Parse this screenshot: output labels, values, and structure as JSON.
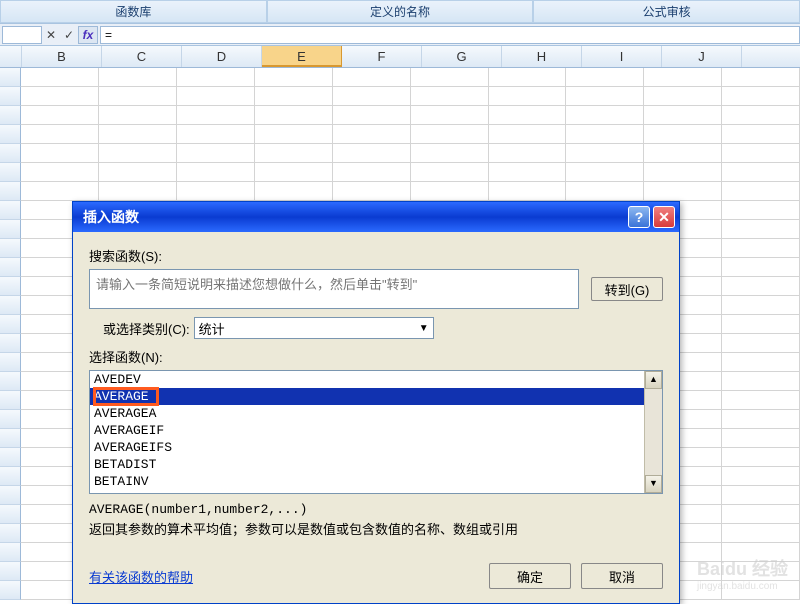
{
  "ribbon": {
    "labels": [
      "函数库",
      "定义的名称",
      "公式审核"
    ]
  },
  "formula_bar": {
    "name_box": "",
    "cancel": "✕",
    "confirm": "✓",
    "fx_label": "fx",
    "value": "="
  },
  "columns": [
    "B",
    "C",
    "D",
    "E",
    "F",
    "G",
    "H",
    "I",
    "J"
  ],
  "active_column": "E",
  "dialog": {
    "title": "插入函数",
    "search_label": "搜索函数(S):",
    "search_placeholder": "请输入一条简短说明来描述您想做什么，然后单击\"转到\"",
    "go_label": "转到(G)",
    "category_label": "或选择类别(C):",
    "category_value": "统计",
    "list_label": "选择函数(N):",
    "functions": [
      "AVEDEV",
      "AVERAGE",
      "AVERAGEA",
      "AVERAGEIF",
      "AVERAGEIFS",
      "BETADIST",
      "BETAINV"
    ],
    "selected_index": 1,
    "syntax": "AVERAGE(number1,number2,...)",
    "description": "返回其参数的算术平均值；参数可以是数值或包含数值的名称、数组或引用",
    "help_link": "有关该函数的帮助",
    "ok_label": "确定",
    "cancel_label": "取消"
  },
  "watermark": {
    "brand": "Baidu 经验",
    "sub": "jingyan.baidu.com"
  }
}
